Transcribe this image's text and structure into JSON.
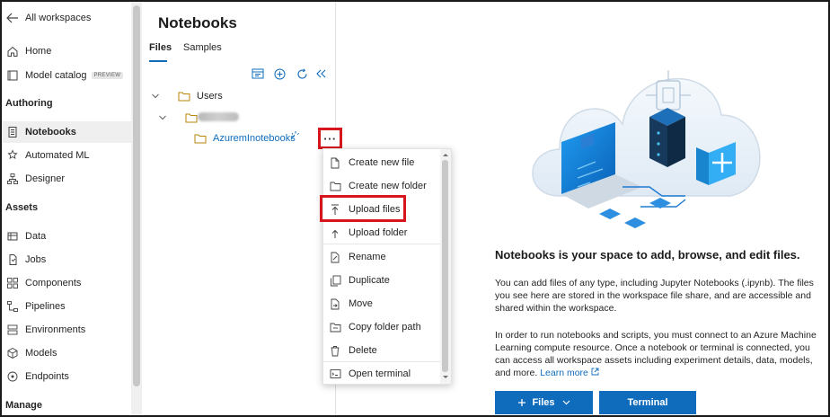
{
  "nav": {
    "back_label": "All workspaces",
    "home": "Home",
    "model_catalog": "Model catalog",
    "preview_badge": "PREVIEW",
    "section_authoring": "Authoring",
    "notebooks": "Notebooks",
    "automated_ml": "Automated ML",
    "designer": "Designer",
    "section_assets": "Assets",
    "data": "Data",
    "jobs": "Jobs",
    "components": "Components",
    "pipelines": "Pipelines",
    "environments": "Environments",
    "models": "Models",
    "endpoints": "Endpoints",
    "section_manage": "Manage"
  },
  "notebooks_pane": {
    "title": "Notebooks",
    "tabs": [
      "Files",
      "Samples"
    ],
    "tree": {
      "users": "Users",
      "azureml_folder": "AzuremInotebooks"
    },
    "ellipsis": "···"
  },
  "context_menu": {
    "items": [
      "Create new file",
      "Create new folder",
      "Upload files",
      "Upload folder",
      "Rename",
      "Duplicate",
      "Move",
      "Copy folder path",
      "Delete",
      "Open terminal"
    ]
  },
  "main": {
    "heading": "Notebooks is your space to add, browse, and edit files.",
    "para1": "You can add files of any type, including Jupyter Notebooks (.ipynb). The files you see here are stored in the workspace file share, and are accessible and shared within the workspace.",
    "para2": "In order to run notebooks and scripts, you must connect to an Azure Machine Learning compute resource. Once a notebook or terminal is connected, you can access all workspace assets including experiment details, data, models, and more.",
    "learn_more": "Learn more",
    "files_button": "Files",
    "terminal_button": "Terminal"
  },
  "colors": {
    "accent": "#0f6cbd",
    "highlight": "#d6151c"
  }
}
